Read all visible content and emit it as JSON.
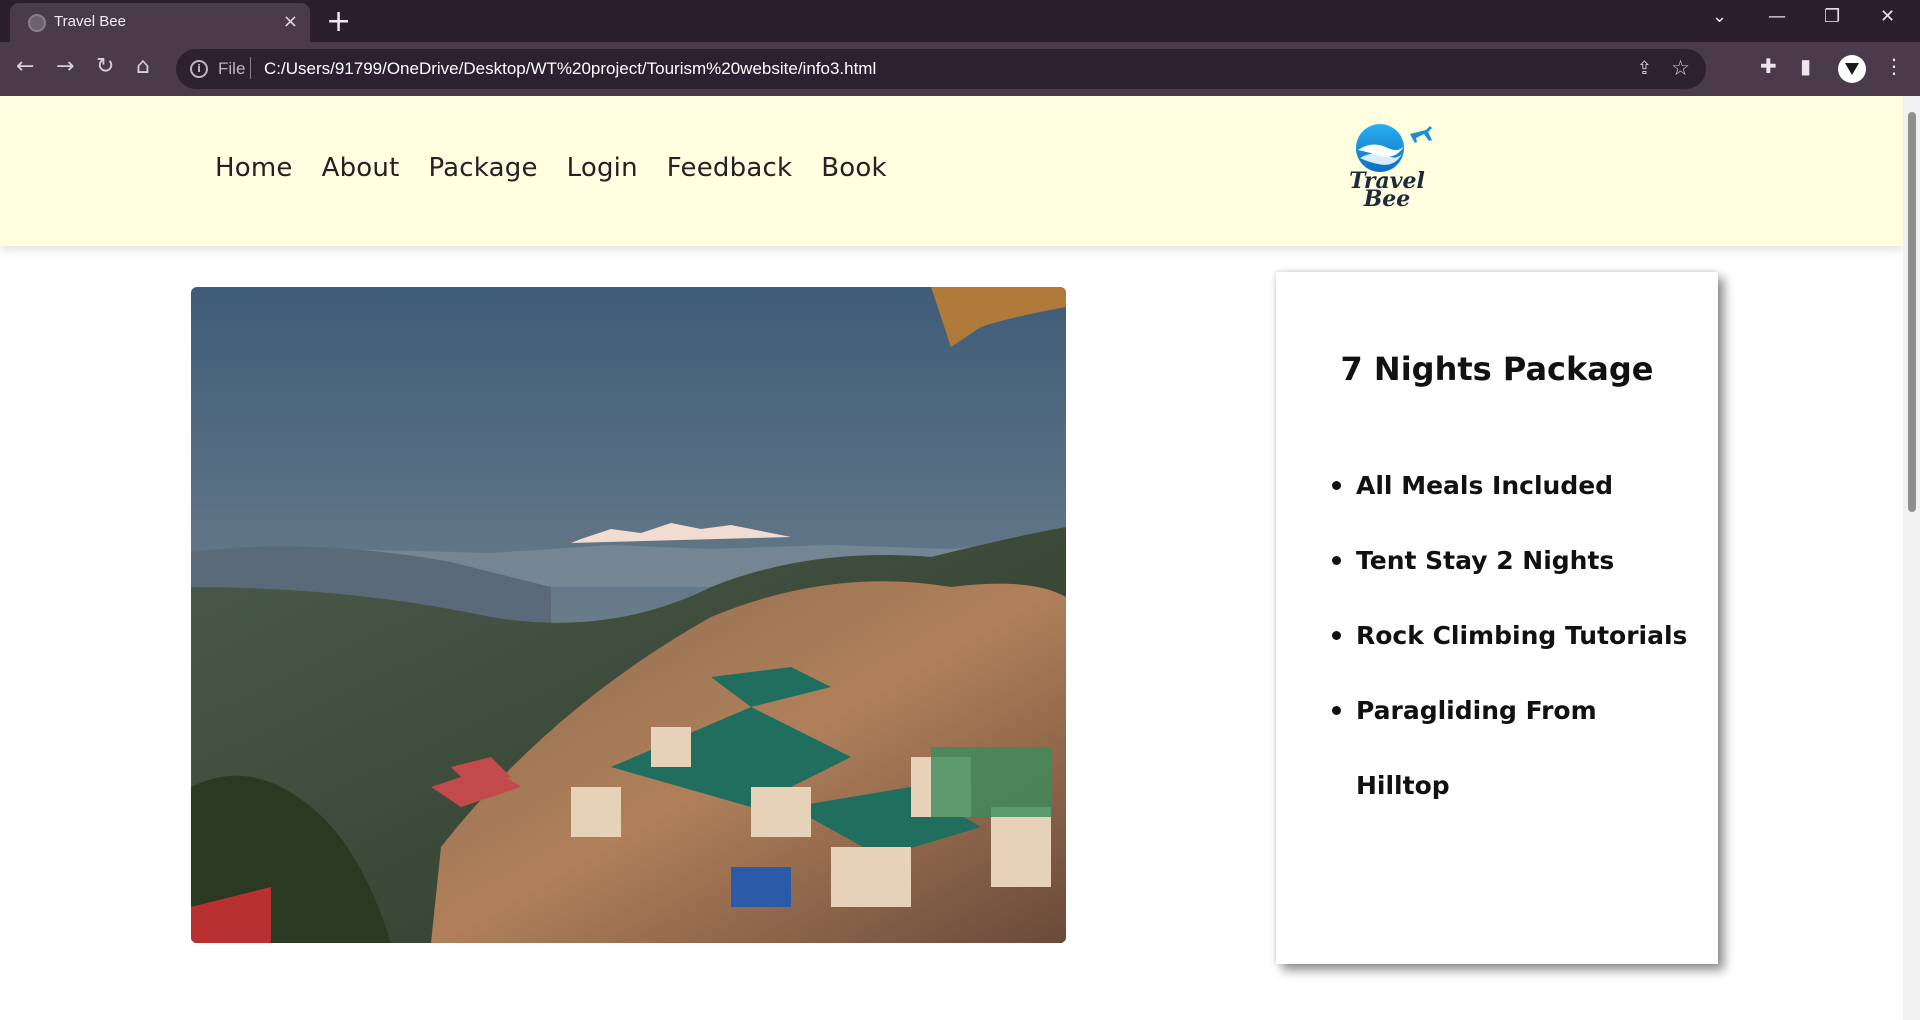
{
  "browser": {
    "tab_title": "Travel Bee",
    "tab_close": "×",
    "new_tab": "+",
    "address_scheme": "File",
    "address_url": "C:/Users/91799/OneDrive/Desktop/WT%20project/Tourism%20website/info3.html"
  },
  "nav": {
    "items": [
      "Home",
      "About",
      "Package",
      "Login",
      "Feedback",
      "Book"
    ]
  },
  "logo": {
    "line1": "Travel",
    "line2": "Bee"
  },
  "package": {
    "title": "7 Nights Package",
    "features": [
      "All Meals Included",
      "Tent Stay 2 Nights",
      "Rock Climbing Tutorials",
      "Paragliding From Hilltop"
    ]
  },
  "colors": {
    "header_bg": "#fffee1",
    "browser_frame": "#2b1e2e",
    "browser_toolbar": "#4a3a4c"
  }
}
